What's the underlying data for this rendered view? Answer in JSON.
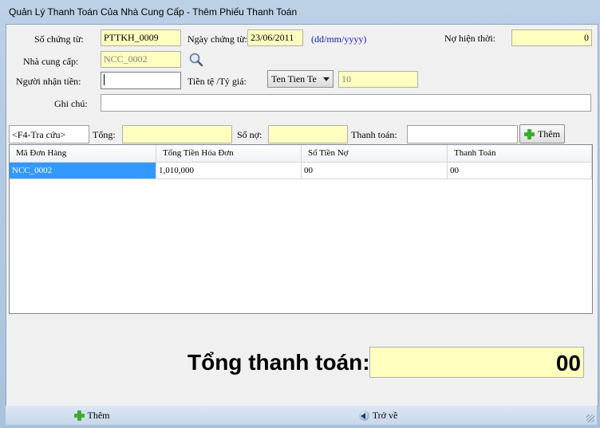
{
  "window": {
    "title": "Quản Lý Thanh Toán Của Nhà Cung Cấp - Thêm Phiếu Thanh Toán"
  },
  "form": {
    "so_chung_tu_label": "Số chứng từ:",
    "so_chung_tu_value": "PTTKH_0009",
    "ngay_chung_tu_label": "Ngày chứng từ:",
    "ngay_chung_tu_value": "23/06/2011",
    "date_hint": "(dd/mm/yyyy)",
    "no_hien_thoi_label": "Nợ hiện thời:",
    "no_hien_thoi_value": "0",
    "nha_cung_cap_label": "Nhà cung cấp:",
    "nha_cung_cap_value": "NCC_0002",
    "nguoi_nhan_tien_label": "Người nhận tiền:",
    "nguoi_nhan_tien_value": "",
    "tien_te_label": "Tiền tệ /Tỷ giá:",
    "tien_te_selected": "Ten Tien Te",
    "ty_gia_value": "10",
    "ghi_chu_label": "Ghi chú:",
    "ghi_chu_value": ""
  },
  "filter_bar": {
    "search_value": "<F4-Tra cứu>",
    "tong_label": "Tổng:",
    "tong_value": "",
    "so_no_label": "Số nợ:",
    "so_no_value": "",
    "thanh_toan_label": "Thanh toán:",
    "thanh_toan_value": "",
    "them_button": "Thêm"
  },
  "table": {
    "columns": [
      "Mã Đơn Hàng",
      "Tổng Tiền Hóa Đơn",
      "Số Tiền Nợ",
      "Thanh Toán"
    ],
    "rows": [
      [
        "NCC_0002",
        "1,010,000",
        "00",
        "00"
      ]
    ]
  },
  "total": {
    "label": "Tổng thanh toán:",
    "value": "00"
  },
  "statusbar": {
    "them_button": "Thêm",
    "tro_ve_button": "Trở về"
  },
  "icons": {
    "lookup": "magnifier-icon",
    "add": "plus-icon",
    "back": "back-arrow-icon"
  },
  "colors": {
    "highlight_field": "#ffffc0",
    "selected_row": "#3399ff",
    "hint_text": "#1515c8"
  }
}
